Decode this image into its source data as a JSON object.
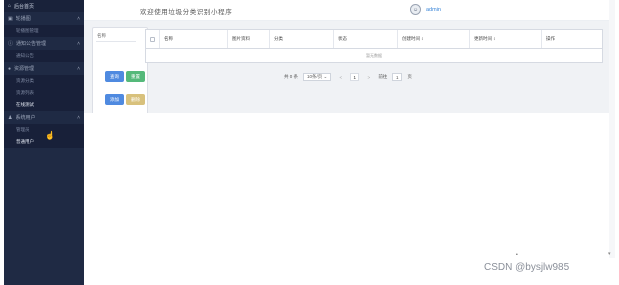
{
  "sidebar": {
    "home": "后台首页",
    "groups": [
      {
        "label": "轮播图",
        "sub": [
          "轮播图管理"
        ]
      },
      {
        "label": "通知公告管理",
        "sub": [
          "通知公告"
        ]
      },
      {
        "label": "资源管理",
        "sub": [
          "资源分类",
          "资源列表",
          "在线测试"
        ]
      },
      {
        "label": "系统用户",
        "sub": [
          "管理员",
          "普通用户"
        ]
      }
    ]
  },
  "header": {
    "title": "欢迎使用垃圾分类识别小程序",
    "username": "admin"
  },
  "search_panel": {
    "name_placeholder": "名称",
    "search_label": "查询",
    "reset_label": "重置",
    "add_label": "添加",
    "delete_label": "删除"
  },
  "table": {
    "columns": [
      "名称",
      "图片资料",
      "分类",
      "状态",
      "创建时间 ↕",
      "更新时间 ↕",
      "操作"
    ],
    "empty_text": "暂无数据"
  },
  "pagination": {
    "total_text": "共 0 条",
    "page_size": "10条/页",
    "prev": "<",
    "current_page": "1",
    "next": ">",
    "goto_label": "前往",
    "goto_value": "1",
    "page_unit": "页"
  },
  "watermark": "CSDN @bysjlw985"
}
